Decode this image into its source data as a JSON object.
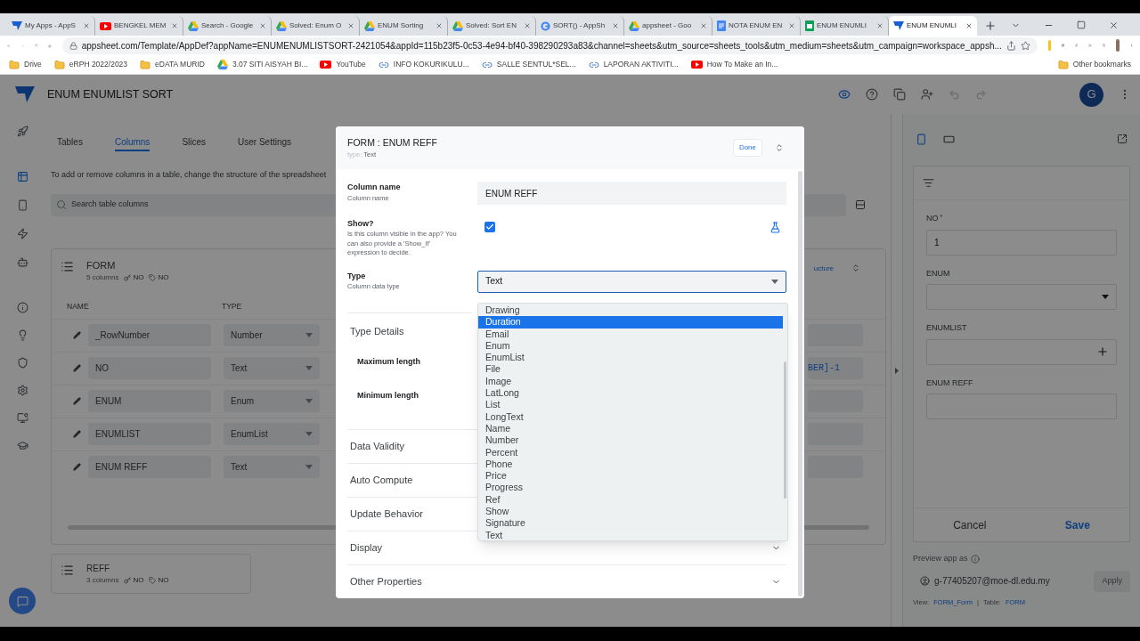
{
  "browser": {
    "tabs": [
      {
        "title": "My Apps - AppS",
        "kind": "appsheet",
        "selected": false
      },
      {
        "title": "BENGKEL MEM",
        "kind": "youtube",
        "selected": false
      },
      {
        "title": "Search - Google",
        "kind": "drive",
        "selected": false
      },
      {
        "title": "Solved: Enum O",
        "kind": "drive",
        "selected": false
      },
      {
        "title": "ENUM Sorting",
        "kind": "drive",
        "selected": false
      },
      {
        "title": "Solved: Sort EN",
        "kind": "drive",
        "selected": false
      },
      {
        "title": "SORT() - AppSh",
        "kind": "google",
        "selected": false
      },
      {
        "title": "appsheet - Goo",
        "kind": "drive",
        "selected": false
      },
      {
        "title": "NOTA ENUM EN",
        "kind": "docs",
        "selected": false
      },
      {
        "title": "ENUM ENUMLI",
        "kind": "sheets",
        "selected": false
      },
      {
        "title": "ENUM ENUMLI",
        "kind": "appsheet",
        "selected": true
      }
    ],
    "url": "appsheet.com/Template/AppDef?appName=ENUMENUMLISTSORT-2421054&appId=115b23f5-0c53-4e94-bf40-398290293a83&channel=sheets&utm_source=sheets_tools&utm_medium=sheets&utm_campaign=workspace_appsh...",
    "bookmarks": [
      {
        "label": "Drive",
        "kind": "folder"
      },
      {
        "label": "eRPH 2022/2023",
        "kind": "folder"
      },
      {
        "label": "eDATA MURID",
        "kind": "folder"
      },
      {
        "label": "3.07 SITI AISYAH BI...",
        "kind": "drive"
      },
      {
        "label": "YouTube",
        "kind": "youtube"
      },
      {
        "label": "INFO KOKURIKULU...",
        "kind": "link"
      },
      {
        "label": "SALLE SENTUL*SEL...",
        "kind": "link"
      },
      {
        "label": "LAPORAN AKTIVITI...",
        "kind": "link"
      },
      {
        "label": "How To Make an In...",
        "kind": "youtube"
      }
    ],
    "other_bookmarks": "Other bookmarks"
  },
  "app": {
    "title": "ENUM ENUMLIST SORT",
    "avatar": "G",
    "nav_tabs": [
      {
        "label": "Tables",
        "selected": false
      },
      {
        "label": "Columns",
        "selected": true
      },
      {
        "label": "Slices",
        "selected": false
      },
      {
        "label": "User Settings",
        "selected": false
      }
    ],
    "hint": "To add or remove columns in a table, change the structure of the spreadsheet",
    "search_placeholder": "Search table columns",
    "table": {
      "name": "FORM",
      "count": "5 columns",
      "key": "NO",
      "label": "NO",
      "headers": [
        "NAME",
        "TYPE"
      ],
      "structure_link": "ucture",
      "rows": [
        {
          "name": "_RowNumber",
          "type": "Number"
        },
        {
          "name": "NO",
          "type": "Text",
          "formula": "BER]-1"
        },
        {
          "name": "ENUM",
          "type": "Enum"
        },
        {
          "name": "ENUMLIST",
          "type": "EnumList"
        },
        {
          "name": "ENUM REFF",
          "type": "Text"
        }
      ]
    },
    "other_table": {
      "name": "REFF",
      "count": "3 columns",
      "key": "NO",
      "label": "NO"
    }
  },
  "dialog": {
    "title": "FORM : ENUM REFF",
    "type_prefix": "type:",
    "type_value": "Text",
    "done": "Done",
    "fields": [
      {
        "kind": "text",
        "label": "Column name",
        "hint": "Column name",
        "value": "ENUM REFF"
      },
      {
        "kind": "checkbox",
        "label": "Show?",
        "hint": "Is this column visible in the app? You can also provide a 'Show_If' expression to decide.",
        "checked": true
      },
      {
        "kind": "select",
        "label": "Type",
        "hint": "Column data type",
        "value": "Text",
        "expanded": true
      }
    ],
    "type_details": "Type Details",
    "detail_items": [
      "Maximum length",
      "Minimum length"
    ],
    "sections": [
      {
        "title": "Data Validity",
        "chevron": false
      },
      {
        "title": "Auto Compute",
        "chevron": false
      },
      {
        "title": "Update Behavior",
        "chevron": false
      },
      {
        "title": "Display",
        "chevron": true
      },
      {
        "title": "Other Properties",
        "chevron": true
      }
    ],
    "options": [
      {
        "label": "Drawing",
        "selected": false
      },
      {
        "label": "Duration",
        "selected": true
      },
      {
        "label": "Email",
        "selected": false
      },
      {
        "label": "Enum",
        "selected": false
      },
      {
        "label": "EnumList",
        "selected": false
      },
      {
        "label": "File",
        "selected": false
      },
      {
        "label": "Image",
        "selected": false
      },
      {
        "label": "LatLong",
        "selected": false
      },
      {
        "label": "List",
        "selected": false
      },
      {
        "label": "LongText",
        "selected": false
      },
      {
        "label": "Name",
        "selected": false
      },
      {
        "label": "Number",
        "selected": false
      },
      {
        "label": "Percent",
        "selected": false
      },
      {
        "label": "Phone",
        "selected": false
      },
      {
        "label": "Price",
        "selected": false
      },
      {
        "label": "Progress",
        "selected": false
      },
      {
        "label": "Ref",
        "selected": false
      },
      {
        "label": "Show",
        "selected": false
      },
      {
        "label": "Signature",
        "selected": false
      },
      {
        "label": "Text",
        "selected": false
      }
    ]
  },
  "preview": {
    "fields": [
      {
        "kind": "text",
        "label": "NO",
        "mark": "*",
        "value": "1"
      },
      {
        "kind": "select",
        "label": "ENUM"
      },
      {
        "kind": "list",
        "label": "ENUMLIST"
      },
      {
        "kind": "text",
        "label": "ENUM REFF"
      }
    ],
    "cancel": "Cancel",
    "save": "Save",
    "preview_as": "Preview app as",
    "email": "g-77405207@moe-dl.edu.my",
    "apply": "Apply",
    "view_label": "View:",
    "view": "FORM_Form",
    "separator": "|",
    "table_label": "Table:",
    "table": "FORM"
  }
}
